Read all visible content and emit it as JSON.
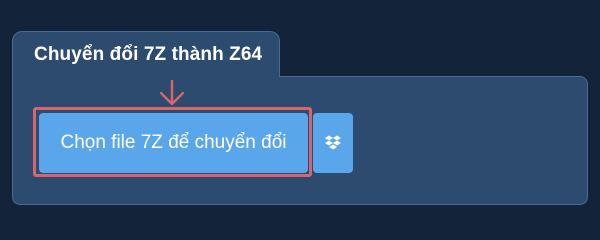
{
  "tab": {
    "title": "Chuyển đổi 7Z thành Z64"
  },
  "upload": {
    "button_label": "Chọn file 7Z để chuyển đổi",
    "dropbox_icon": "dropbox-icon"
  },
  "annotation": {
    "arrow_icon": "arrow-down-icon",
    "color": "#d9656a"
  },
  "colors": {
    "background": "#13233a",
    "panel": "#2d4b6f",
    "button": "#5aa6eb"
  }
}
